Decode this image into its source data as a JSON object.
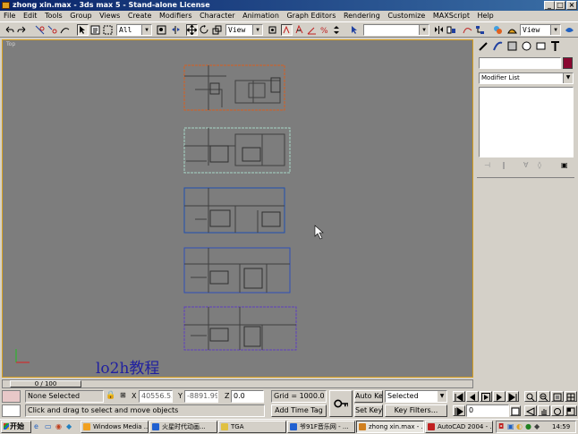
{
  "window": {
    "title": "zhong xin.max - 3ds max 5 - Stand-alone License"
  },
  "menu": [
    "File",
    "Edit",
    "Tools",
    "Group",
    "Views",
    "Create",
    "Modifiers",
    "Character",
    "Animation",
    "Graph Editors",
    "Rendering",
    "Customize",
    "MAXScript",
    "Help"
  ],
  "toolbar": {
    "selection_filter": "All",
    "ref_coord": "View",
    "named_selection": "",
    "render_type": "View"
  },
  "viewport": {
    "label": "Top",
    "watermark": "lo2h教程"
  },
  "floor_plans": [
    {
      "color": "#d86020"
    },
    {
      "color": "#a8d8c8"
    },
    {
      "color": "#2050b0"
    },
    {
      "color": "#3050b8"
    },
    {
      "color": "#6040c0"
    }
  ],
  "timeline": {
    "frame": "0 / 100"
  },
  "command_panel": {
    "modifier_list": "Modifier List",
    "swatch_color": "#8a0830"
  },
  "status": {
    "selection": "None Selected",
    "prompt": "Click and drag to select and move objects",
    "x_label": "X",
    "x_value": "40556.53",
    "y_label": "Y",
    "y_value": "-8891.99",
    "z_label": "Z",
    "z_value": "0.0",
    "grid": "Grid = 1000.0",
    "add_time_tag": "Add Time Tag",
    "auto_key": "Auto Key",
    "set_key": "Set Key",
    "key_mode": "Selected",
    "key_filters": "Key Filters...",
    "frame_field": "0"
  },
  "taskbar": {
    "start": "开始",
    "tasks": [
      {
        "label": "Windows Media ...",
        "color": "#f0a020"
      },
      {
        "label": "火星时代动画...",
        "color": "#2060d0"
      },
      {
        "label": "TGA",
        "color": "#e0c040"
      },
      {
        "label": "爷91F音乐网 - ...",
        "color": "#2060d0"
      },
      {
        "label": "zhong xin.max - ...",
        "color": "#d08020"
      },
      {
        "label": "AutoCAD 2004 - ...",
        "color": "#c02020"
      }
    ],
    "clock": "14:59"
  }
}
